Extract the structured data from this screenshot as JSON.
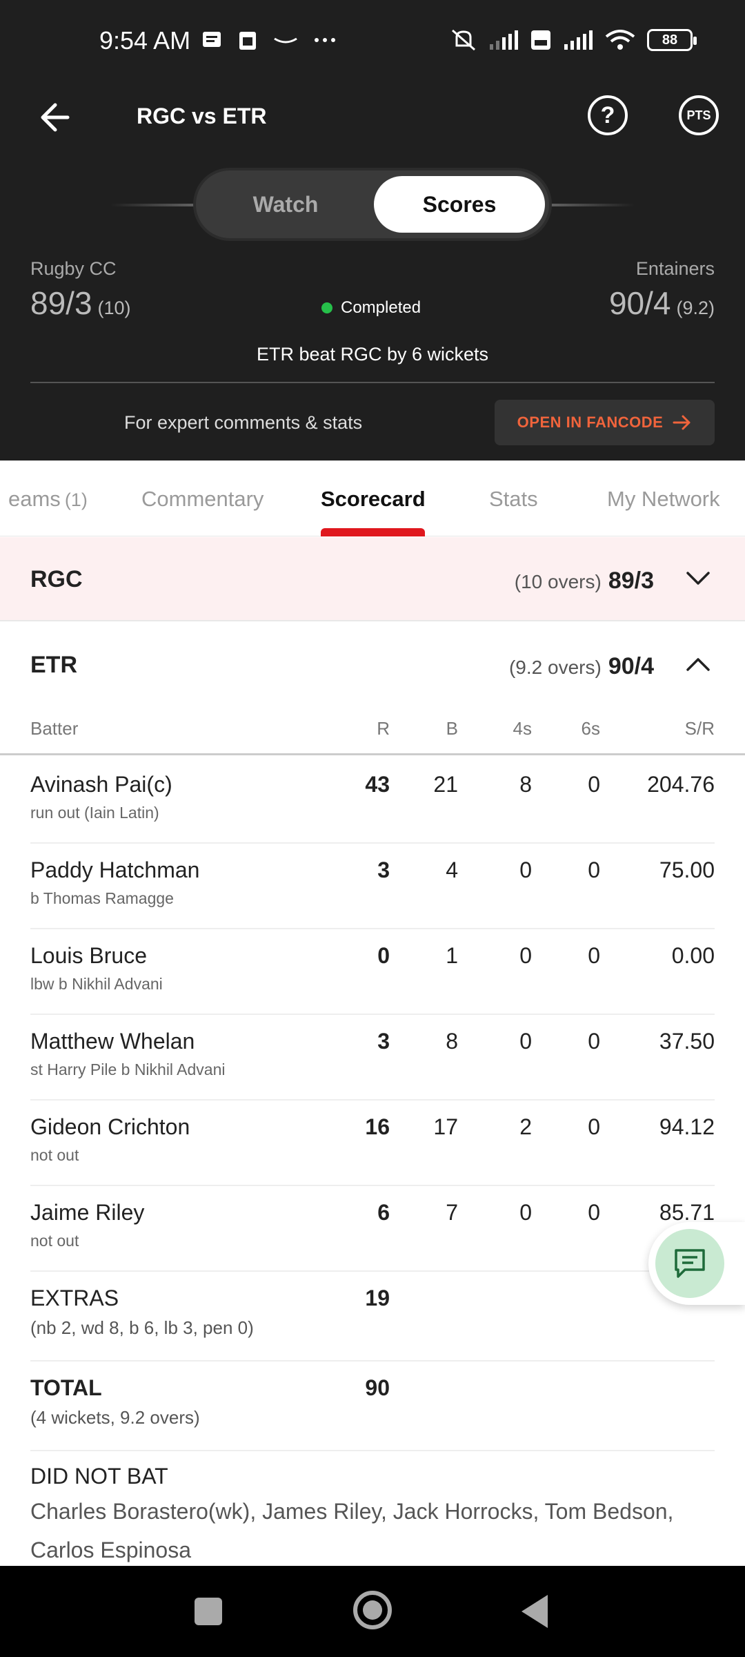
{
  "status_bar": {
    "time": "9:54 AM",
    "battery": "88"
  },
  "header": {
    "title": "RGC vs ETR",
    "pts_label": "PTS"
  },
  "toggle": {
    "watch": "Watch",
    "scores": "Scores"
  },
  "match": {
    "team1_name": "Rugby CC",
    "team1_score": "89/3",
    "team1_overs": "(10)",
    "team2_name": "Entainers",
    "team2_score": "90/4",
    "team2_overs": "(9.2)",
    "status": "Completed",
    "result": "ETR beat RGC by 6 wickets"
  },
  "promo": {
    "text": "For expert comments & stats",
    "button": "OPEN IN FANCODE"
  },
  "tabs": [
    {
      "label": "eams",
      "count": "(1)"
    },
    {
      "label": "Commentary"
    },
    {
      "label": "Scorecard"
    },
    {
      "label": "Stats"
    },
    {
      "label": "My Network"
    }
  ],
  "innings": [
    {
      "team": "RGC",
      "overs": "(10 overs)",
      "score": "89/3"
    },
    {
      "team": "ETR",
      "overs": "(9.2 overs)",
      "score": "90/4"
    }
  ],
  "table_header": {
    "batter": "Batter",
    "r": "R",
    "b": "B",
    "fours": "4s",
    "sixes": "6s",
    "sr": "S/R"
  },
  "batters": [
    {
      "name": "Avinash Pai(c)",
      "dismissal": "run out (Iain Latin)",
      "r": "43",
      "b": "21",
      "fours": "8",
      "sixes": "0",
      "sr": "204.76"
    },
    {
      "name": "Paddy Hatchman",
      "dismissal": "b Thomas Ramagge",
      "r": "3",
      "b": "4",
      "fours": "0",
      "sixes": "0",
      "sr": "75.00"
    },
    {
      "name": "Louis Bruce",
      "dismissal": "lbw b Nikhil Advani",
      "r": "0",
      "b": "1",
      "fours": "0",
      "sixes": "0",
      "sr": "0.00"
    },
    {
      "name": "Matthew Whelan",
      "dismissal": "st Harry Pile b Nikhil Advani",
      "r": "3",
      "b": "8",
      "fours": "0",
      "sixes": "0",
      "sr": "37.50"
    },
    {
      "name": "Gideon Crichton",
      "dismissal": "not out",
      "r": "16",
      "b": "17",
      "fours": "2",
      "sixes": "0",
      "sr": "94.12"
    },
    {
      "name": "Jaime Riley",
      "dismissal": "not out",
      "r": "6",
      "b": "7",
      "fours": "0",
      "sixes": "0",
      "sr": "85.71"
    }
  ],
  "extras": {
    "label": "EXTRAS",
    "detail": "(nb 2, wd 8, b 6, lb 3, pen 0)",
    "value": "19"
  },
  "total": {
    "label": "TOTAL",
    "detail": "(4 wickets, 9.2 overs)",
    "value": "90"
  },
  "did_not_bat": {
    "label": "DID NOT BAT",
    "players": "Charles Borastero(wk), James Riley, Jack Horrocks, Tom Bedson, Carlos Espinosa"
  },
  "colors": {
    "header_bg": "#1f1f1f",
    "accent_red": "#e0181e",
    "fancode_orange": "#f0643c",
    "completed_green": "#26c04a",
    "rgc_row_bg": "#fdf0f1"
  }
}
